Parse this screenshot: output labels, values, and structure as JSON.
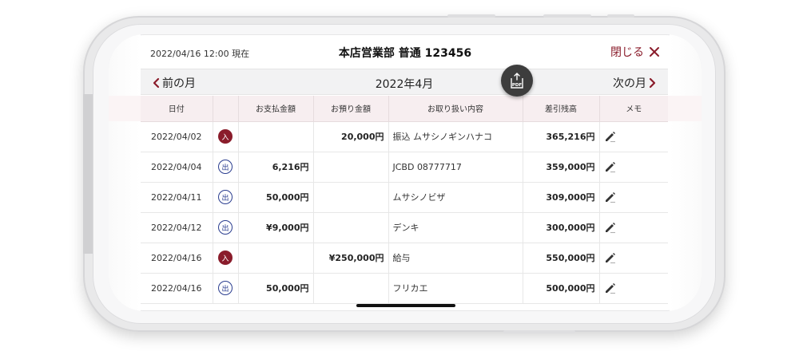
{
  "header": {
    "timestamp": "2022/04/16 12:00 現在",
    "account_title": "本店営業部 普通 123456",
    "close_label": "閉じる"
  },
  "month_nav": {
    "prev_label": "前の月",
    "current_label": "2022年4月",
    "next_label": "次の月"
  },
  "pdf_button": {
    "label": "PDF",
    "icon": "pdf-export-icon"
  },
  "table": {
    "columns": [
      "日付",
      "",
      "お支払金額",
      "お預り金額",
      "お取り扱い内容",
      "差引残高",
      "メモ"
    ],
    "rows": [
      {
        "date": "2022/04/02",
        "type": "入",
        "type_kind": "deposit",
        "payment": "",
        "deposit": "20,000円",
        "description": "振込 ムサシノギンハナコ",
        "balance": "365,216円"
      },
      {
        "date": "2022/04/04",
        "type": "出",
        "type_kind": "withdrawal",
        "payment": "6,216円",
        "deposit": "",
        "description": "JCBD 08777717",
        "balance": "359,000円"
      },
      {
        "date": "2022/04/11",
        "type": "出",
        "type_kind": "withdrawal",
        "payment": "50,000円",
        "deposit": "",
        "description": "ムサシノビザ",
        "balance": "309,000円"
      },
      {
        "date": "2022/04/12",
        "type": "出",
        "type_kind": "withdrawal",
        "payment": "¥9,000円",
        "deposit": "",
        "description": "デンキ",
        "balance": "300,000円"
      },
      {
        "date": "2022/04/16",
        "type": "入",
        "type_kind": "deposit",
        "payment": "",
        "deposit": "¥250,000円",
        "description": "給与",
        "balance": "550,000円"
      },
      {
        "date": "2022/04/16",
        "type": "出",
        "type_kind": "withdrawal",
        "payment": "50,000円",
        "deposit": "",
        "description": "フリカエ",
        "balance": "500,000円"
      }
    ]
  },
  "colors": {
    "accent": "#8a1c2b",
    "withdrawal": "#2a3d8f",
    "header_bg": "#f7eef0"
  }
}
